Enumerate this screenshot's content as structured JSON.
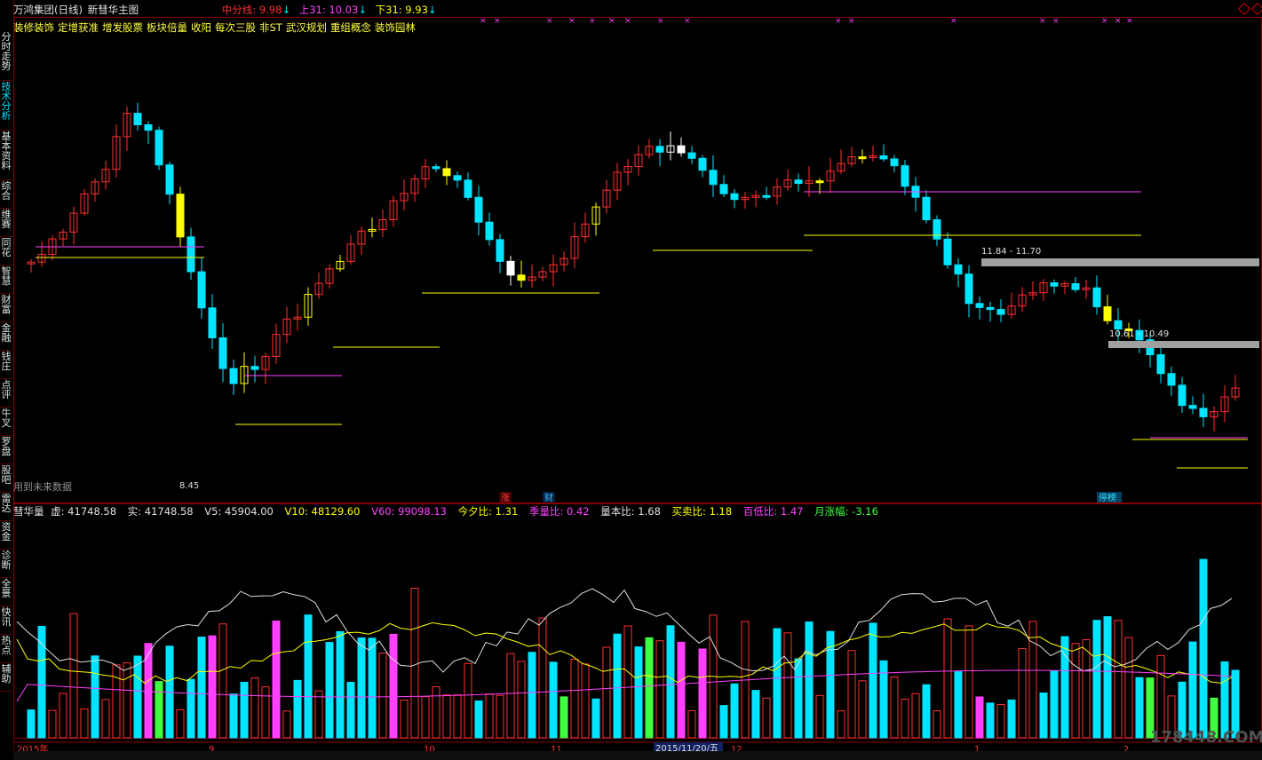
{
  "header": {
    "stock_name": "万鸿集团(日线)",
    "template": "新彗华主图",
    "mid_line": "中分线: 9.98",
    "upper": "上31: 10.03",
    "lower": "下31: 9.93"
  },
  "concept_tags": [
    "装修装饰",
    "定增获准",
    "增发股票",
    "板块倍量",
    "收阳",
    "每次三股",
    "非ST",
    "武汉规划",
    "重组概念",
    "装饰园林"
  ],
  "sidebar": {
    "tabs": [
      "分时走势",
      "技术分析",
      "基本资料",
      "综合",
      "维赛",
      "同花",
      "智慧",
      "财富",
      "金融",
      "钱庄",
      "点评",
      "牛叉",
      "罗盘",
      "股吧",
      "雷达",
      "资金",
      "诊断",
      "全景",
      "快讯",
      "热点",
      "辅助"
    ],
    "active_index": 1
  },
  "price_chart": {
    "future_data_note": "用到未来数据",
    "low_marker": "8.45",
    "range_label_1": "11.84 - 11.70",
    "range_label_2": "10.61 - 10.49",
    "badge_zhang": "涨",
    "badge_cai": "财",
    "badge_tingbang": "停榜"
  },
  "volume_panel": {
    "name": "彗华量",
    "virtual": "虚: 41748.58",
    "real": "实: 41748.58",
    "v5": "V5: 45904.00",
    "v10": "V10: 48129.60",
    "v60": "V60: 99098.13",
    "today_ratio": "今夕比: 1.31",
    "season_ratio": "季量比: 0.42",
    "volume_ratio": "量本比: 1.68",
    "trade_ratio": "买卖比: 1.18",
    "high_low_ratio": "百低比: 1.47",
    "month_change": "月涨幅: -3.16"
  },
  "time_axis": {
    "year_label": "2015年",
    "months": [
      "9",
      "10",
      "11",
      "12",
      "1",
      "2"
    ],
    "cursor_date": "2015/11/20/五"
  },
  "watermark": "178448.COM",
  "colors": {
    "up": "#ff3030",
    "down": "#00e5ff",
    "yellow": "#ffff00",
    "magenta": "#ff40ff",
    "grid": "#8b0000"
  }
}
